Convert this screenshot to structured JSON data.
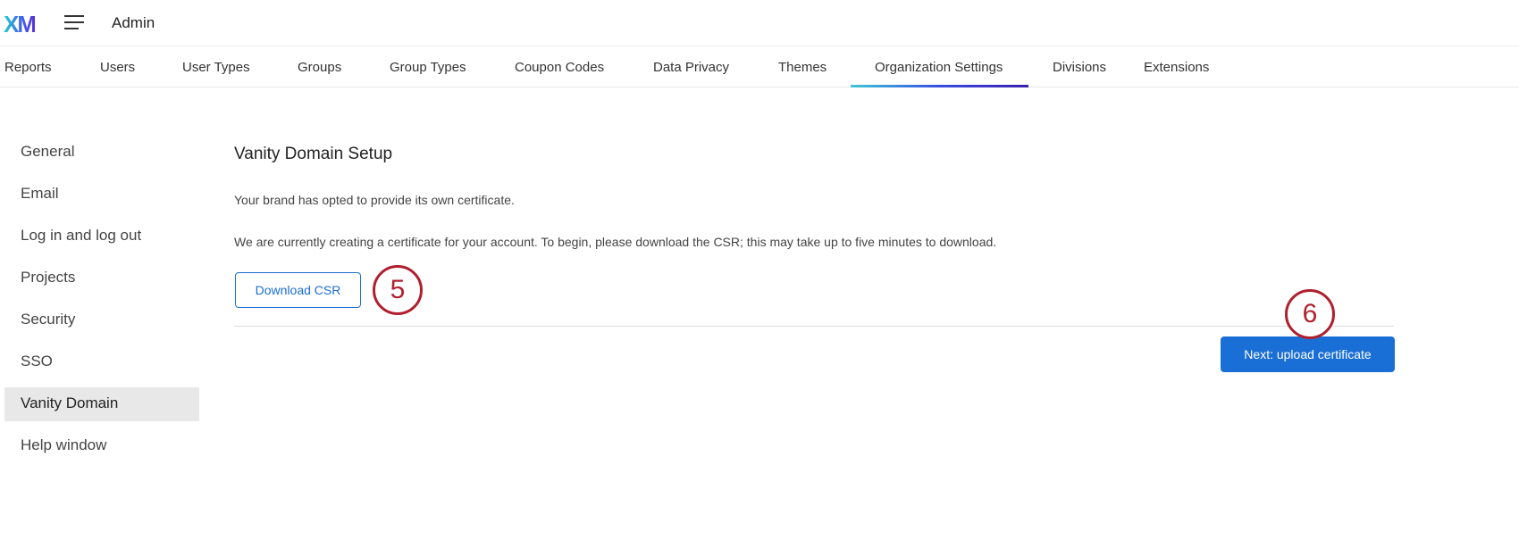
{
  "header": {
    "logo": "XM",
    "title": "Admin"
  },
  "tabs": [
    "Reports",
    "Users",
    "User Types",
    "Groups",
    "Group Types",
    "Coupon Codes",
    "Data Privacy",
    "Themes",
    "Organization Settings",
    "Divisions",
    "Extensions"
  ],
  "active_tab": "Organization Settings",
  "sidebar": [
    "General",
    "Email",
    "Log in and log out",
    "Projects",
    "Security",
    "SSO",
    "Vanity Domain",
    "Help window"
  ],
  "active_sidebar": "Vanity Domain",
  "main": {
    "title": "Vanity Domain Setup",
    "p1": "Your brand has opted to provide its own certificate.",
    "p2": "We are currently creating a certificate for your account. To begin, please download the CSR; this may take up to five minutes to download.",
    "download_label": "Download CSR",
    "next_label": "Next: upload certificate"
  },
  "annotations": {
    "step5": "5",
    "step6": "6"
  },
  "colors": {
    "accent": "#1a6fd6",
    "annotation": "#b01f2e"
  }
}
